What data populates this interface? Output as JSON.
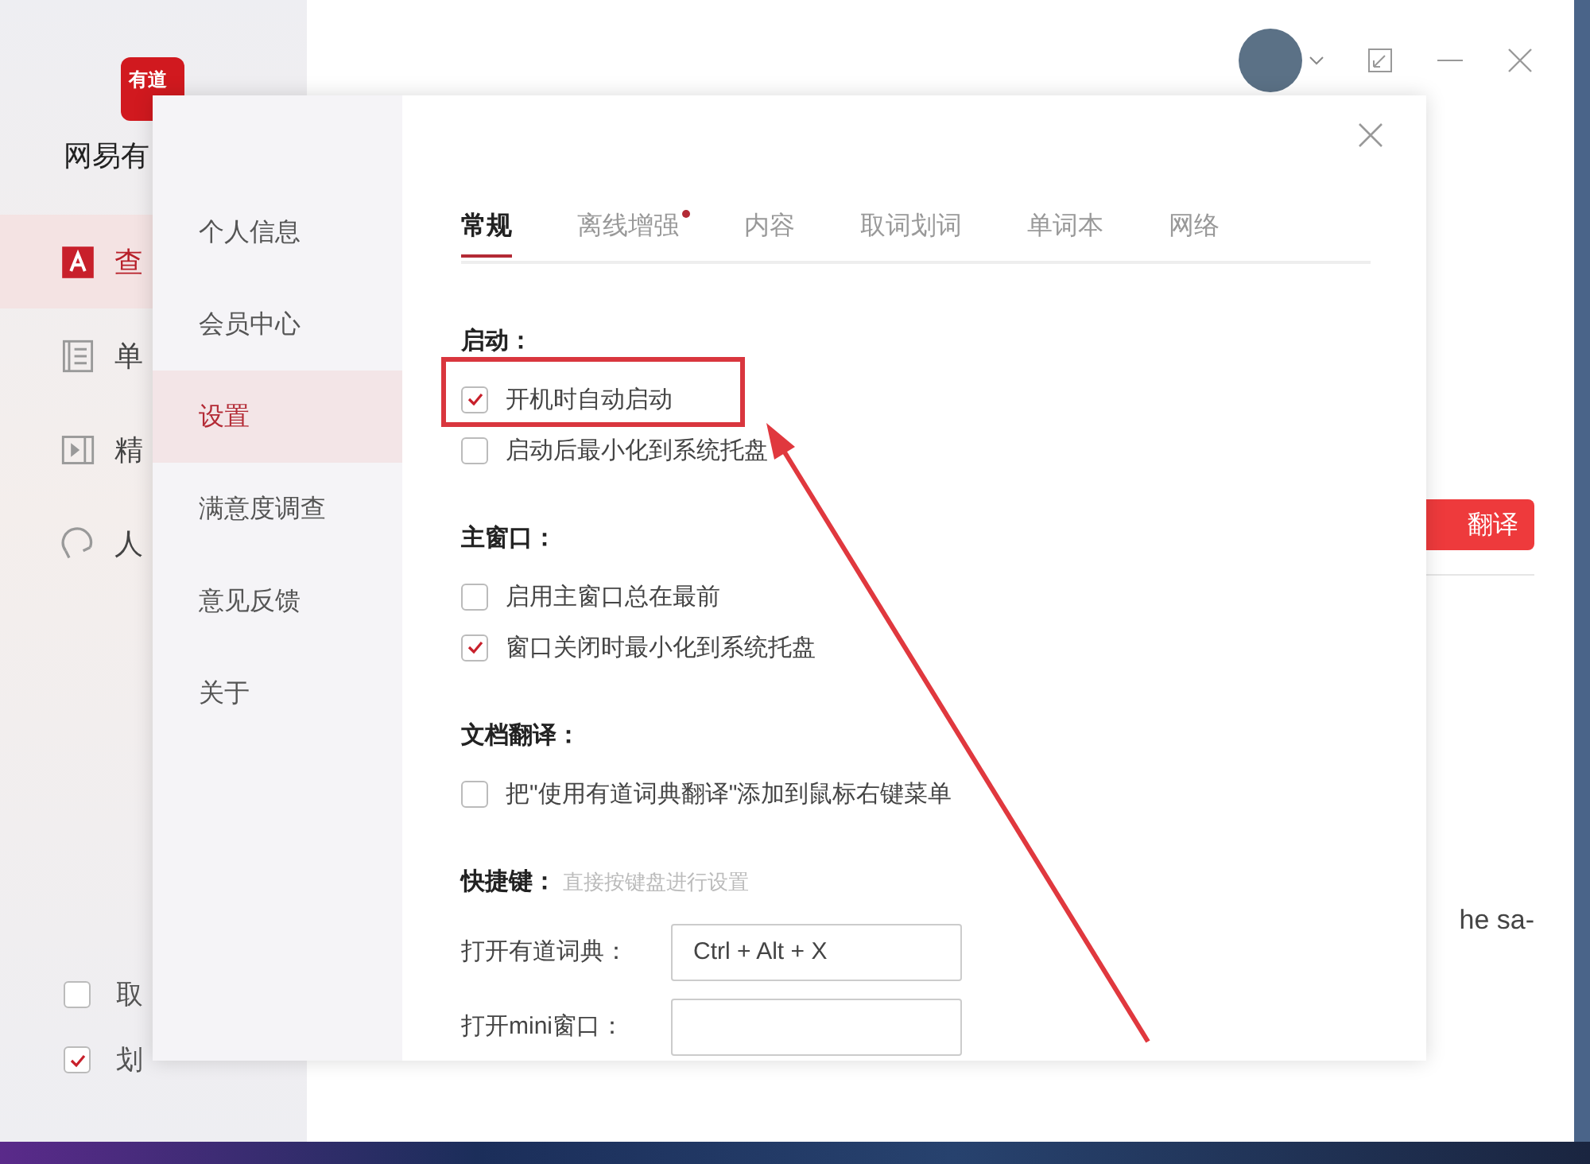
{
  "app": {
    "logo": "有道",
    "name": "网易有",
    "nav": [
      {
        "label": "查",
        "selected": true
      },
      {
        "label": "单",
        "selected": false
      },
      {
        "label": "精",
        "selected": false
      },
      {
        "label": "人",
        "selected": false
      }
    ],
    "options": [
      {
        "label": "取",
        "checked": false
      },
      {
        "label": "划",
        "checked": true
      }
    ],
    "translate_button": "翻译",
    "snippet": "he sa-"
  },
  "dialog": {
    "menu": [
      {
        "label": "个人信息",
        "selected": false
      },
      {
        "label": "会员中心",
        "selected": false
      },
      {
        "label": "设置",
        "selected": true
      },
      {
        "label": "满意度调查",
        "selected": false
      },
      {
        "label": "意见反馈",
        "selected": false
      },
      {
        "label": "关于",
        "selected": false
      }
    ],
    "tabs": [
      {
        "label": "常规",
        "selected": true,
        "badge": false
      },
      {
        "label": "离线增强",
        "selected": false,
        "badge": true
      },
      {
        "label": "内容",
        "selected": false,
        "badge": false
      },
      {
        "label": "取词划词",
        "selected": false,
        "badge": false
      },
      {
        "label": "单词本",
        "selected": false,
        "badge": false
      },
      {
        "label": "网络",
        "selected": false,
        "badge": false
      }
    ],
    "sections": [
      {
        "title": "启动：",
        "items": [
          {
            "kind": "checkbox",
            "label": "开机时自动启动",
            "checked": true
          },
          {
            "kind": "checkbox",
            "label": "启动后最小化到系统托盘",
            "checked": false
          }
        ]
      },
      {
        "title": "主窗口：",
        "items": [
          {
            "kind": "checkbox",
            "label": "启用主窗口总在最前",
            "checked": false
          },
          {
            "kind": "checkbox",
            "label": "窗口关闭时最小化到系统托盘",
            "checked": true
          }
        ]
      },
      {
        "title": "文档翻译：",
        "items": [
          {
            "kind": "checkbox",
            "label": "把\"使用有道词典翻译\"添加到鼠标右键菜单",
            "checked": false
          }
        ]
      },
      {
        "title": "快捷键：",
        "hint": "直接按键盘进行设置",
        "items": [
          {
            "kind": "shortcut",
            "label": "打开有道词典：",
            "value": "Ctrl + Alt + X"
          },
          {
            "kind": "shortcut",
            "label": "打开mini窗口："
          }
        ]
      }
    ]
  }
}
